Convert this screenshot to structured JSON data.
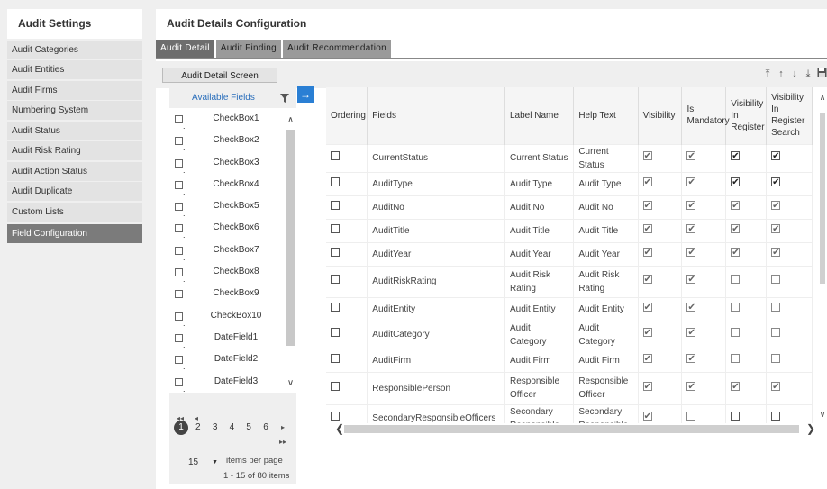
{
  "sidebar": {
    "title": "Audit Settings",
    "items": [
      {
        "label": "Audit Categories",
        "active": false
      },
      {
        "label": "Audit Entities",
        "active": false
      },
      {
        "label": "Audit Firms",
        "active": false
      },
      {
        "label": "Numbering System",
        "active": false
      },
      {
        "label": "Audit Status",
        "active": false
      },
      {
        "label": "Audit Risk Rating",
        "active": false
      },
      {
        "label": "Audit Action Status",
        "active": false
      },
      {
        "label": "Audit Duplicate",
        "active": false
      },
      {
        "label": "Custom Lists",
        "active": false
      },
      {
        "label": "Field Configuration",
        "active": true
      }
    ]
  },
  "main": {
    "title": "Audit Details Configuration",
    "tabs": [
      {
        "label": "Audit Detail",
        "active": true
      },
      {
        "label": "Audit Finding",
        "active": false
      },
      {
        "label": "Audit Recommendation",
        "active": false
      }
    ],
    "screen_button": "Audit Detail Screen",
    "toolbar_icons": [
      "move-top-icon",
      "move-up-icon",
      "move-down-icon",
      "move-bottom-icon",
      "save-icon"
    ]
  },
  "available_fields": {
    "header": "Available Fields",
    "items": [
      "CheckBox1",
      "CheckBox2",
      "CheckBox3",
      "CheckBox4",
      "CheckBox5",
      "CheckBox6",
      "CheckBox7",
      "CheckBox8",
      "CheckBox9",
      "CheckBox10",
      "DateField1",
      "DateField2",
      "DateField3"
    ],
    "pager": {
      "pages": [
        "1",
        "2",
        "3",
        "4",
        "5",
        "6"
      ],
      "current_page": "1",
      "page_size": "15",
      "items_per_page_label": "items per page",
      "range_label": "1 - 15 of 80 items"
    }
  },
  "grid": {
    "columns": [
      "Ordering",
      "Fields",
      "Label Name",
      "Help Text",
      "Visibility",
      "Is Mandatory",
      "Visibility In Register",
      "Visibility In Register Search"
    ],
    "rows": [
      {
        "field": "CurrentStatus",
        "label": "Current Status",
        "help": "Current Status",
        "vis": true,
        "mand": true,
        "reg": true,
        "search": true,
        "dim": false
      },
      {
        "field": "AuditType",
        "label": "Audit Type",
        "help": "Audit Type",
        "vis": true,
        "mand": true,
        "reg": true,
        "search": true,
        "dim": false
      },
      {
        "field": "AuditNo",
        "label": "Audit No",
        "help": "Audit No",
        "vis": true,
        "mand": true,
        "reg": true,
        "search": true,
        "dim": true
      },
      {
        "field": "AuditTitle",
        "label": "Audit Title",
        "help": "Audit Title",
        "vis": true,
        "mand": true,
        "reg": true,
        "search": true,
        "dim": true
      },
      {
        "field": "AuditYear",
        "label": "Audit Year",
        "help": "Audit Year",
        "vis": true,
        "mand": true,
        "reg": true,
        "search": true,
        "dim": true
      },
      {
        "field": "AuditRiskRating",
        "label": "Audit Risk Rating",
        "help": "Audit Risk Rating",
        "vis": true,
        "mand": true,
        "reg": false,
        "search": false,
        "dim": true
      },
      {
        "field": "AuditEntity",
        "label": "Audit Entity",
        "help": "Audit Entity",
        "vis": true,
        "mand": true,
        "reg": false,
        "search": false,
        "dim": true
      },
      {
        "field": "AuditCategory",
        "label": "Audit Category",
        "help": "Audit Category",
        "vis": true,
        "mand": true,
        "reg": false,
        "search": false,
        "dim": true
      },
      {
        "field": "AuditFirm",
        "label": "Audit Firm",
        "help": "Audit Firm",
        "vis": true,
        "mand": true,
        "reg": false,
        "search": false,
        "dim": true
      },
      {
        "field": "ResponsiblePerson",
        "label": "Responsible Officer",
        "help": "Responsible Officer",
        "vis": true,
        "mand": true,
        "reg": true,
        "search": true,
        "dim": true
      },
      {
        "field": "SecondaryResponsibleOfficers",
        "label": "Secondary Responsible",
        "help": "Secondary Responsible",
        "vis": true,
        "mand": false,
        "reg": false,
        "search": false,
        "dim": false
      }
    ]
  }
}
